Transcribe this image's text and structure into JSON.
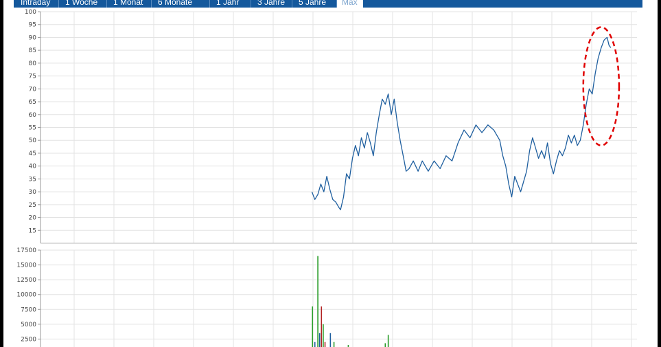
{
  "tabs": [
    {
      "label": "Intraday",
      "active": false
    },
    {
      "label": "1 Woche",
      "active": false
    },
    {
      "label": "1 Monat",
      "active": false
    },
    {
      "label": "6 Monate",
      "active": false
    },
    {
      "label": "1 Jahr",
      "active": false
    },
    {
      "label": "3 Jahre",
      "active": false
    },
    {
      "label": "5 Jahre",
      "active": false
    },
    {
      "label": "Max",
      "active": true
    }
  ],
  "colors": {
    "tab_bar": "#14589c",
    "price_line": "#1f5f9f",
    "grid": "#e3e3e3",
    "annotation": "#e00000",
    "volume_up": "#2a9d2a",
    "volume_down": "#b22222",
    "volume_neutral": "#1f5f9f"
  },
  "chart_data": [
    {
      "type": "line",
      "name": "price",
      "title": "",
      "xlabel": "",
      "ylabel": "",
      "ylim": [
        10,
        100
      ],
      "yticks": [
        15,
        20,
        25,
        30,
        35,
        40,
        45,
        50,
        55,
        60,
        65,
        70,
        75,
        80,
        85,
        90,
        95,
        100
      ],
      "grid": true,
      "x_index_range": [
        0,
        100
      ],
      "series": [
        {
          "values": [
            {
              "x": 45.5,
              "y": 30
            },
            {
              "x": 46,
              "y": 27
            },
            {
              "x": 46.5,
              "y": 29
            },
            {
              "x": 47,
              "y": 33
            },
            {
              "x": 47.5,
              "y": 30
            },
            {
              "x": 48,
              "y": 36
            },
            {
              "x": 48.5,
              "y": 31
            },
            {
              "x": 49,
              "y": 27
            },
            {
              "x": 49.5,
              "y": 26
            },
            {
              "x": 50,
              "y": 24
            },
            {
              "x": 50.3,
              "y": 23
            },
            {
              "x": 50.8,
              "y": 28
            },
            {
              "x": 51.3,
              "y": 37
            },
            {
              "x": 51.8,
              "y": 35
            },
            {
              "x": 52.3,
              "y": 43
            },
            {
              "x": 52.8,
              "y": 48
            },
            {
              "x": 53.3,
              "y": 44
            },
            {
              "x": 53.8,
              "y": 51
            },
            {
              "x": 54.3,
              "y": 47
            },
            {
              "x": 54.8,
              "y": 53
            },
            {
              "x": 55.3,
              "y": 49
            },
            {
              "x": 55.8,
              "y": 44
            },
            {
              "x": 56.3,
              "y": 53
            },
            {
              "x": 56.8,
              "y": 60
            },
            {
              "x": 57.3,
              "y": 66
            },
            {
              "x": 57.8,
              "y": 64
            },
            {
              "x": 58.3,
              "y": 68
            },
            {
              "x": 58.8,
              "y": 60
            },
            {
              "x": 59.3,
              "y": 66
            },
            {
              "x": 59.8,
              "y": 57
            },
            {
              "x": 60.3,
              "y": 50
            },
            {
              "x": 60.8,
              "y": 44
            },
            {
              "x": 61.3,
              "y": 38
            },
            {
              "x": 61.8,
              "y": 39
            },
            {
              "x": 62.5,
              "y": 42
            },
            {
              "x": 63.3,
              "y": 38
            },
            {
              "x": 64,
              "y": 42
            },
            {
              "x": 65,
              "y": 38
            },
            {
              "x": 66,
              "y": 42
            },
            {
              "x": 67,
              "y": 39
            },
            {
              "x": 68,
              "y": 44
            },
            {
              "x": 69,
              "y": 42
            },
            {
              "x": 70,
              "y": 49
            },
            {
              "x": 71,
              "y": 54
            },
            {
              "x": 72,
              "y": 51
            },
            {
              "x": 73,
              "y": 56
            },
            {
              "x": 74,
              "y": 53
            },
            {
              "x": 75,
              "y": 56
            },
            {
              "x": 76,
              "y": 54
            },
            {
              "x": 77,
              "y": 50
            },
            {
              "x": 77.5,
              "y": 44
            },
            {
              "x": 78,
              "y": 40
            },
            {
              "x": 78.5,
              "y": 33
            },
            {
              "x": 79,
              "y": 28
            },
            {
              "x": 79.5,
              "y": 36
            },
            {
              "x": 80,
              "y": 33
            },
            {
              "x": 80.5,
              "y": 30
            },
            {
              "x": 81,
              "y": 34
            },
            {
              "x": 81.5,
              "y": 38
            },
            {
              "x": 82,
              "y": 46
            },
            {
              "x": 82.5,
              "y": 51
            },
            {
              "x": 83,
              "y": 47
            },
            {
              "x": 83.5,
              "y": 43
            },
            {
              "x": 84,
              "y": 46
            },
            {
              "x": 84.5,
              "y": 43
            },
            {
              "x": 85,
              "y": 49
            },
            {
              "x": 85.5,
              "y": 41
            },
            {
              "x": 86,
              "y": 37
            },
            {
              "x": 86.5,
              "y": 42
            },
            {
              "x": 87,
              "y": 46
            },
            {
              "x": 87.5,
              "y": 44
            },
            {
              "x": 88,
              "y": 47
            },
            {
              "x": 88.5,
              "y": 52
            },
            {
              "x": 89,
              "y": 49
            },
            {
              "x": 89.5,
              "y": 52
            },
            {
              "x": 90,
              "y": 48
            },
            {
              "x": 90.5,
              "y": 50
            },
            {
              "x": 91,
              "y": 56
            },
            {
              "x": 91.5,
              "y": 64
            },
            {
              "x": 92,
              "y": 70
            },
            {
              "x": 92.5,
              "y": 68
            },
            {
              "x": 93,
              "y": 76
            },
            {
              "x": 93.5,
              "y": 82
            },
            {
              "x": 94,
              "y": 86
            },
            {
              "x": 94.5,
              "y": 89
            },
            {
              "x": 95,
              "y": 90
            },
            {
              "x": 95.3,
              "y": 87
            },
            {
              "x": 95.6,
              "y": 86
            }
          ]
        }
      ],
      "annotation": {
        "shape": "dashed-ellipse",
        "color": "#e00000",
        "x_range": [
          91,
          97
        ],
        "y_range": [
          48,
          94
        ]
      }
    },
    {
      "type": "bar",
      "name": "volume",
      "title": "",
      "xlabel": "",
      "ylabel": "",
      "ylim": [
        0,
        17500
      ],
      "yticks": [
        2500,
        5000,
        7500,
        10000,
        12500,
        15000,
        17500
      ],
      "grid": true,
      "series": [
        {
          "values": [
            {
              "x": 45.6,
              "y": 8000,
              "c": "up"
            },
            {
              "x": 46.0,
              "y": 2000,
              "c": "neutral"
            },
            {
              "x": 46.5,
              "y": 16500,
              "c": "up"
            },
            {
              "x": 46.8,
              "y": 3500,
              "c": "neutral"
            },
            {
              "x": 47.1,
              "y": 8000,
              "c": "down"
            },
            {
              "x": 47.4,
              "y": 5000,
              "c": "up"
            },
            {
              "x": 47.7,
              "y": 2000,
              "c": "down"
            },
            {
              "x": 48.6,
              "y": 3500,
              "c": "neutral"
            },
            {
              "x": 49.2,
              "y": 2000,
              "c": "up"
            },
            {
              "x": 51.6,
              "y": 1500,
              "c": "up"
            },
            {
              "x": 58.3,
              "y": 3200,
              "c": "up"
            },
            {
              "x": 57.8,
              "y": 1800,
              "c": "up"
            }
          ]
        }
      ]
    }
  ]
}
